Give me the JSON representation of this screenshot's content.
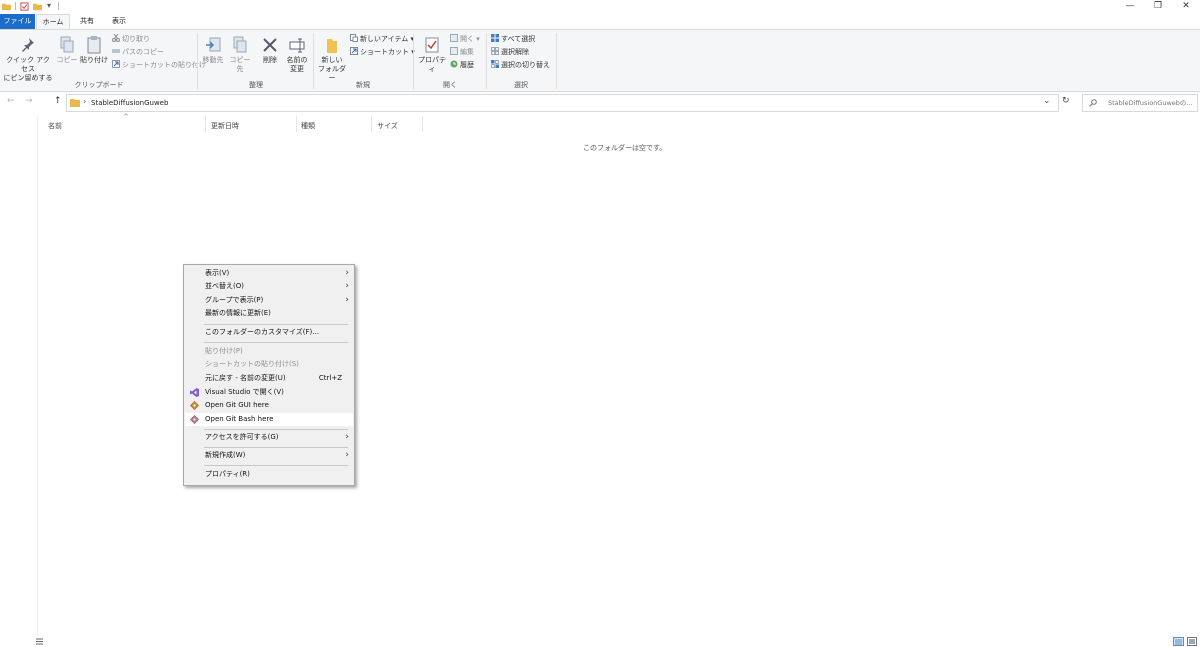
{
  "titlebar": {
    "qa_sep": "|",
    "qa_dropdown": "▾",
    "minimize": "—",
    "restore": "❐",
    "close": "✕"
  },
  "tabs": [
    "ファイル",
    "ホーム",
    "共有",
    "表示"
  ],
  "ribbon": {
    "clipboard": {
      "pin_line1": "クイック アクセス",
      "pin_line2": "にピン留めする",
      "copy": "コピー",
      "paste": "貼り付け",
      "cut": "切り取り",
      "copy_path": "パスのコピー",
      "paste_shortcut": "ショートカットの貼り付け",
      "label": "クリップボード"
    },
    "organize": {
      "move_to": "移動先",
      "copy_to": "コピー先",
      "delete": "削除",
      "rename_line1": "名前の",
      "rename_line2": "変更",
      "label": "整理"
    },
    "new": {
      "new_folder_line1": "新しい",
      "new_folder_line2": "フォルダー",
      "new_item": "新しいアイテム ▾",
      "shortcut": "ショートカット ▾",
      "label": "新規"
    },
    "open": {
      "properties": "プロパティ",
      "open": "開く ▾",
      "edit": "編集",
      "history": "履歴",
      "label": "開く"
    },
    "select": {
      "select_all": "すべて選択",
      "select_none": "選択解除",
      "invert": "選択の切り替え",
      "label": "選択"
    }
  },
  "nav": {
    "back": "←",
    "forward": "→",
    "up": "↑",
    "crumb_chevron": "›",
    "path": "StableDiffusionGuweb",
    "dropdown": "⌄",
    "refresh": "↻",
    "search_placeholder": "StableDiffusionGuwebの..."
  },
  "columns": [
    "名前",
    "更新日時",
    "種類",
    "サイズ"
  ],
  "sort_arrow": "^",
  "empty_text": "このフォルダーは空です。",
  "context_menu": [
    {
      "label": "表示(V)",
      "submenu": true
    },
    {
      "label": "並べ替え(O)",
      "submenu": true
    },
    {
      "label": "グループで表示(P)",
      "submenu": true
    },
    {
      "label": "最新の情報に更新(E)"
    },
    {
      "label": "このフォルダーのカスタマイズ(F)..."
    },
    {
      "label": "貼り付け(P)",
      "disabled": true
    },
    {
      "label": "ショートカットの貼り付け(S)",
      "disabled": true
    },
    {
      "label": "元に戻す - 名前の変更(U)",
      "shortcut": "Ctrl+Z"
    },
    {
      "label": "Visual Studio で開く(V)",
      "icon": "visual-studio-icon"
    },
    {
      "label": "Open Git GUI here",
      "icon": "git-icon"
    },
    {
      "label": "Open Git Bash here",
      "icon": "git-icon",
      "highlighted": true
    },
    {
      "label": "アクセスを許可する(G)",
      "submenu": true
    },
    {
      "label": "新規作成(W)",
      "submenu": true
    },
    {
      "label": "プロパティ(R)"
    }
  ],
  "submenu_arrow": "›",
  "colors": {
    "file_tab": "#1a6ec9",
    "ribbon_bg": "#f5f6f7",
    "menu_bg": "#f0f0f0",
    "vs_purple": "#865fc5",
    "git_orange": "#f05133"
  }
}
